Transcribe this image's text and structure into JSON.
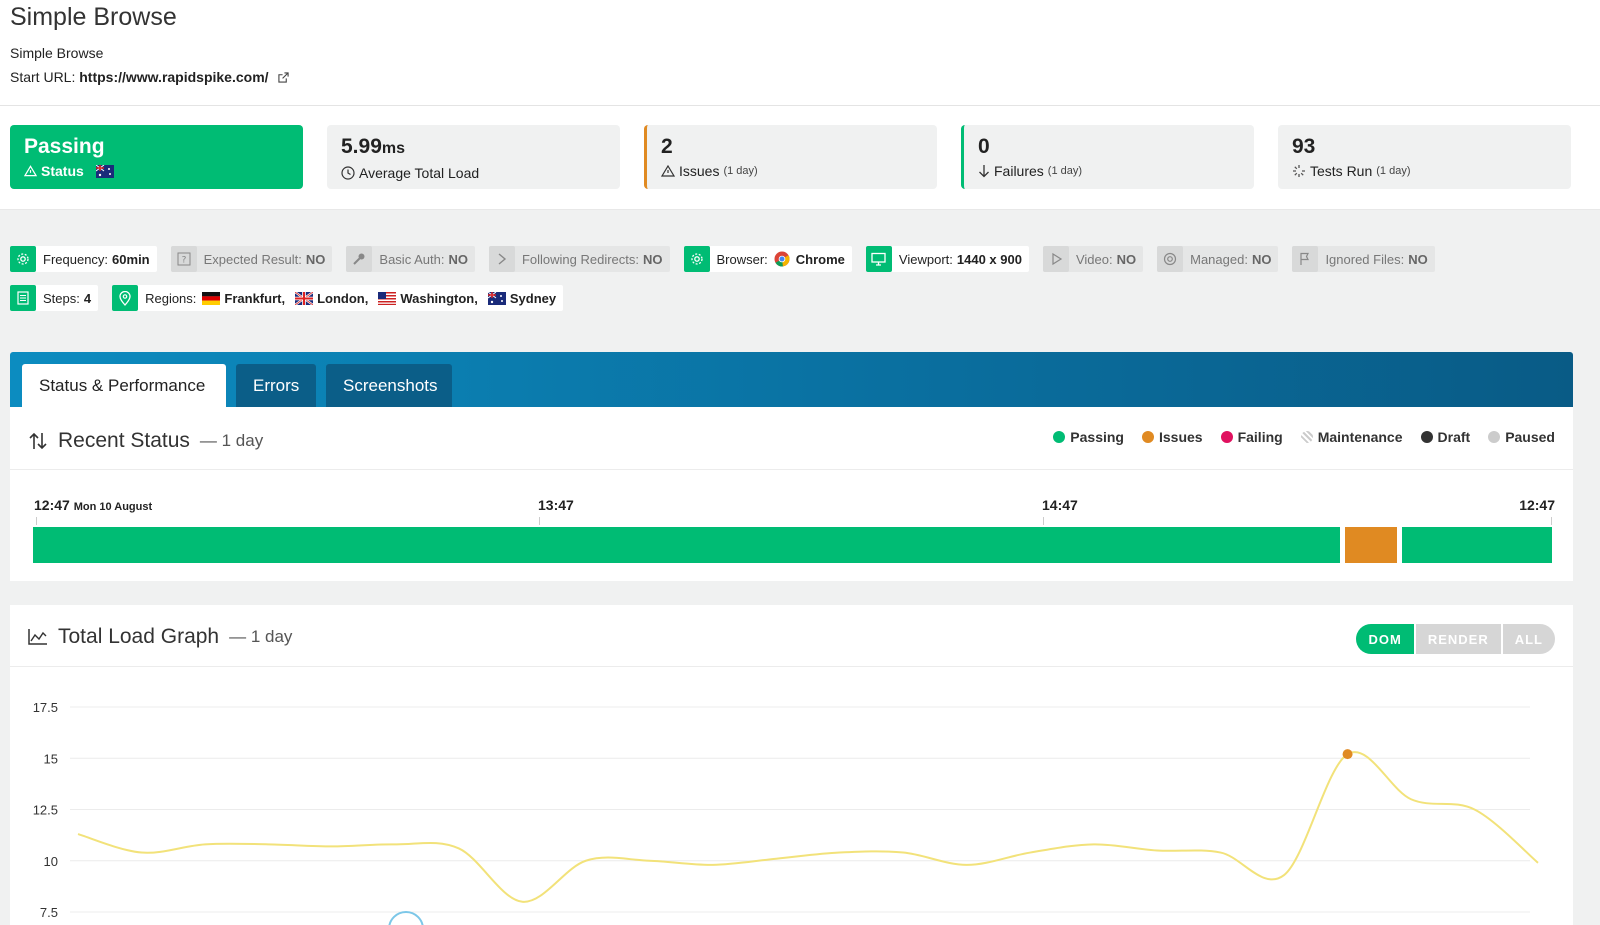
{
  "header": {
    "title": "Simple Browse",
    "subtitle": "Simple Browse",
    "start_url_label": "Start URL:",
    "start_url": "https://www.rapidspike.com/"
  },
  "summary": [
    {
      "value": "Passing",
      "unit": "",
      "label": "Status",
      "note": ""
    },
    {
      "value": "5.99",
      "unit": "ms",
      "label": "Average Total Load",
      "note": ""
    },
    {
      "value": "2",
      "unit": "",
      "label": "Issues",
      "note": "(1 day)"
    },
    {
      "value": "0",
      "unit": "",
      "label": "Failures",
      "note": "(1 day)"
    },
    {
      "value": "93",
      "unit": "",
      "label": "Tests Run",
      "note": "(1 day)"
    }
  ],
  "tags": {
    "frequency": {
      "label": "Frequency:",
      "value": "60min"
    },
    "expected": {
      "label": "Expected Result:",
      "value": "NO"
    },
    "basic_auth": {
      "label": "Basic Auth:",
      "value": "NO"
    },
    "redirects": {
      "label": "Following Redirects:",
      "value": "NO"
    },
    "browser": {
      "label": "Browser:",
      "value": "Chrome"
    },
    "viewport": {
      "label": "Viewport:",
      "value": "1440 x 900"
    },
    "video": {
      "label": "Video:",
      "value": "NO"
    },
    "managed": {
      "label": "Managed:",
      "value": "NO"
    },
    "ignored": {
      "label": "Ignored Files:",
      "value": "NO"
    },
    "steps": {
      "label": "Steps:",
      "value": "4"
    },
    "regions": {
      "label": "Regions:",
      "items": [
        "Frankfurt,",
        "London,",
        "Washington,",
        "Sydney"
      ]
    }
  },
  "tabs": [
    "Status & Performance",
    "Errors",
    "Screenshots"
  ],
  "recent_status": {
    "title": "Recent Status",
    "period": "— 1 day",
    "legend": [
      "Passing",
      "Issues",
      "Failing",
      "Maintenance",
      "Draft",
      "Paused"
    ],
    "timeline": {
      "start": "12:47",
      "start_date": "Mon 10 August",
      "t2": "13:47",
      "t3": "14:47",
      "end": "12:47"
    }
  },
  "total_load": {
    "title": "Total Load Graph",
    "period": "— 1 day",
    "buttons": [
      "DOM",
      "RENDER",
      "ALL"
    ]
  },
  "colors": {
    "passing": "#00bc74",
    "issues": "#e08a22",
    "failing": "#e0115f",
    "draft": "#333333",
    "paused": "#cccccc",
    "line": "#f2e27a"
  },
  "chart_data": {
    "type": "line",
    "title": "",
    "xlabel": "",
    "ylabel": "",
    "yticks": [
      "17.5",
      "15",
      "12.5",
      "10",
      "7.5"
    ],
    "ylim": [
      7.5,
      17.5
    ],
    "series": [
      {
        "values": [
          11.3,
          10.4,
          10.8,
          10.8,
          10.7,
          10.8,
          10.6,
          8.0,
          10.0,
          10.0,
          9.8,
          10.1,
          10.4,
          10.4,
          9.8,
          10.4,
          10.8,
          10.5,
          10.4,
          9.3,
          15.2,
          13.0,
          12.5,
          9.9
        ]
      }
    ],
    "highlight_point": {
      "index": 20,
      "value": 15.2
    }
  }
}
